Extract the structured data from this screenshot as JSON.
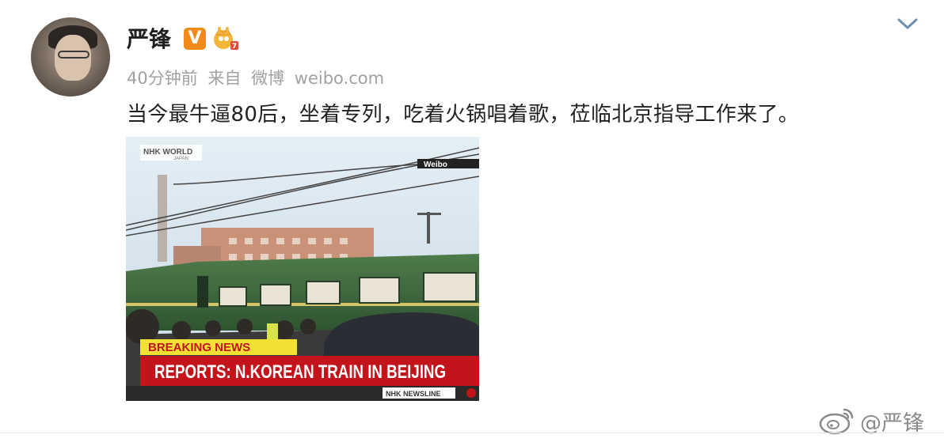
{
  "user": {
    "name": "严锋",
    "verified_badge": "V",
    "avatar_icon": "user-avatar",
    "vip_icon": "crown-icon"
  },
  "meta": {
    "time": "40分钟前",
    "from_label": "来自",
    "app": "微博",
    "site": "weibo.com"
  },
  "post": {
    "text": "当今最牛逼80后，坐着专列，吃着火锅唱着歌，莅临北京指导工作来了。"
  },
  "media": {
    "logo_top": "NHK WORLD",
    "logo_sub": "JAPAN",
    "source_tag": "Weibo",
    "breaking_label": "BREAKING NEWS",
    "headline": "REPORTS: N.KOREAN TRAIN IN BEIJING",
    "logo_bottom": "NHK NEWSLINE"
  },
  "watermark": {
    "text": "@严锋",
    "icon": "weibo-logo-icon"
  },
  "colors": {
    "verified": "#f28a1a",
    "train_green": "#3f6a3e",
    "breaking_yellow": "#f2e035",
    "headline_red": "#c3141c",
    "meta_gray": "#a1a1a1"
  }
}
